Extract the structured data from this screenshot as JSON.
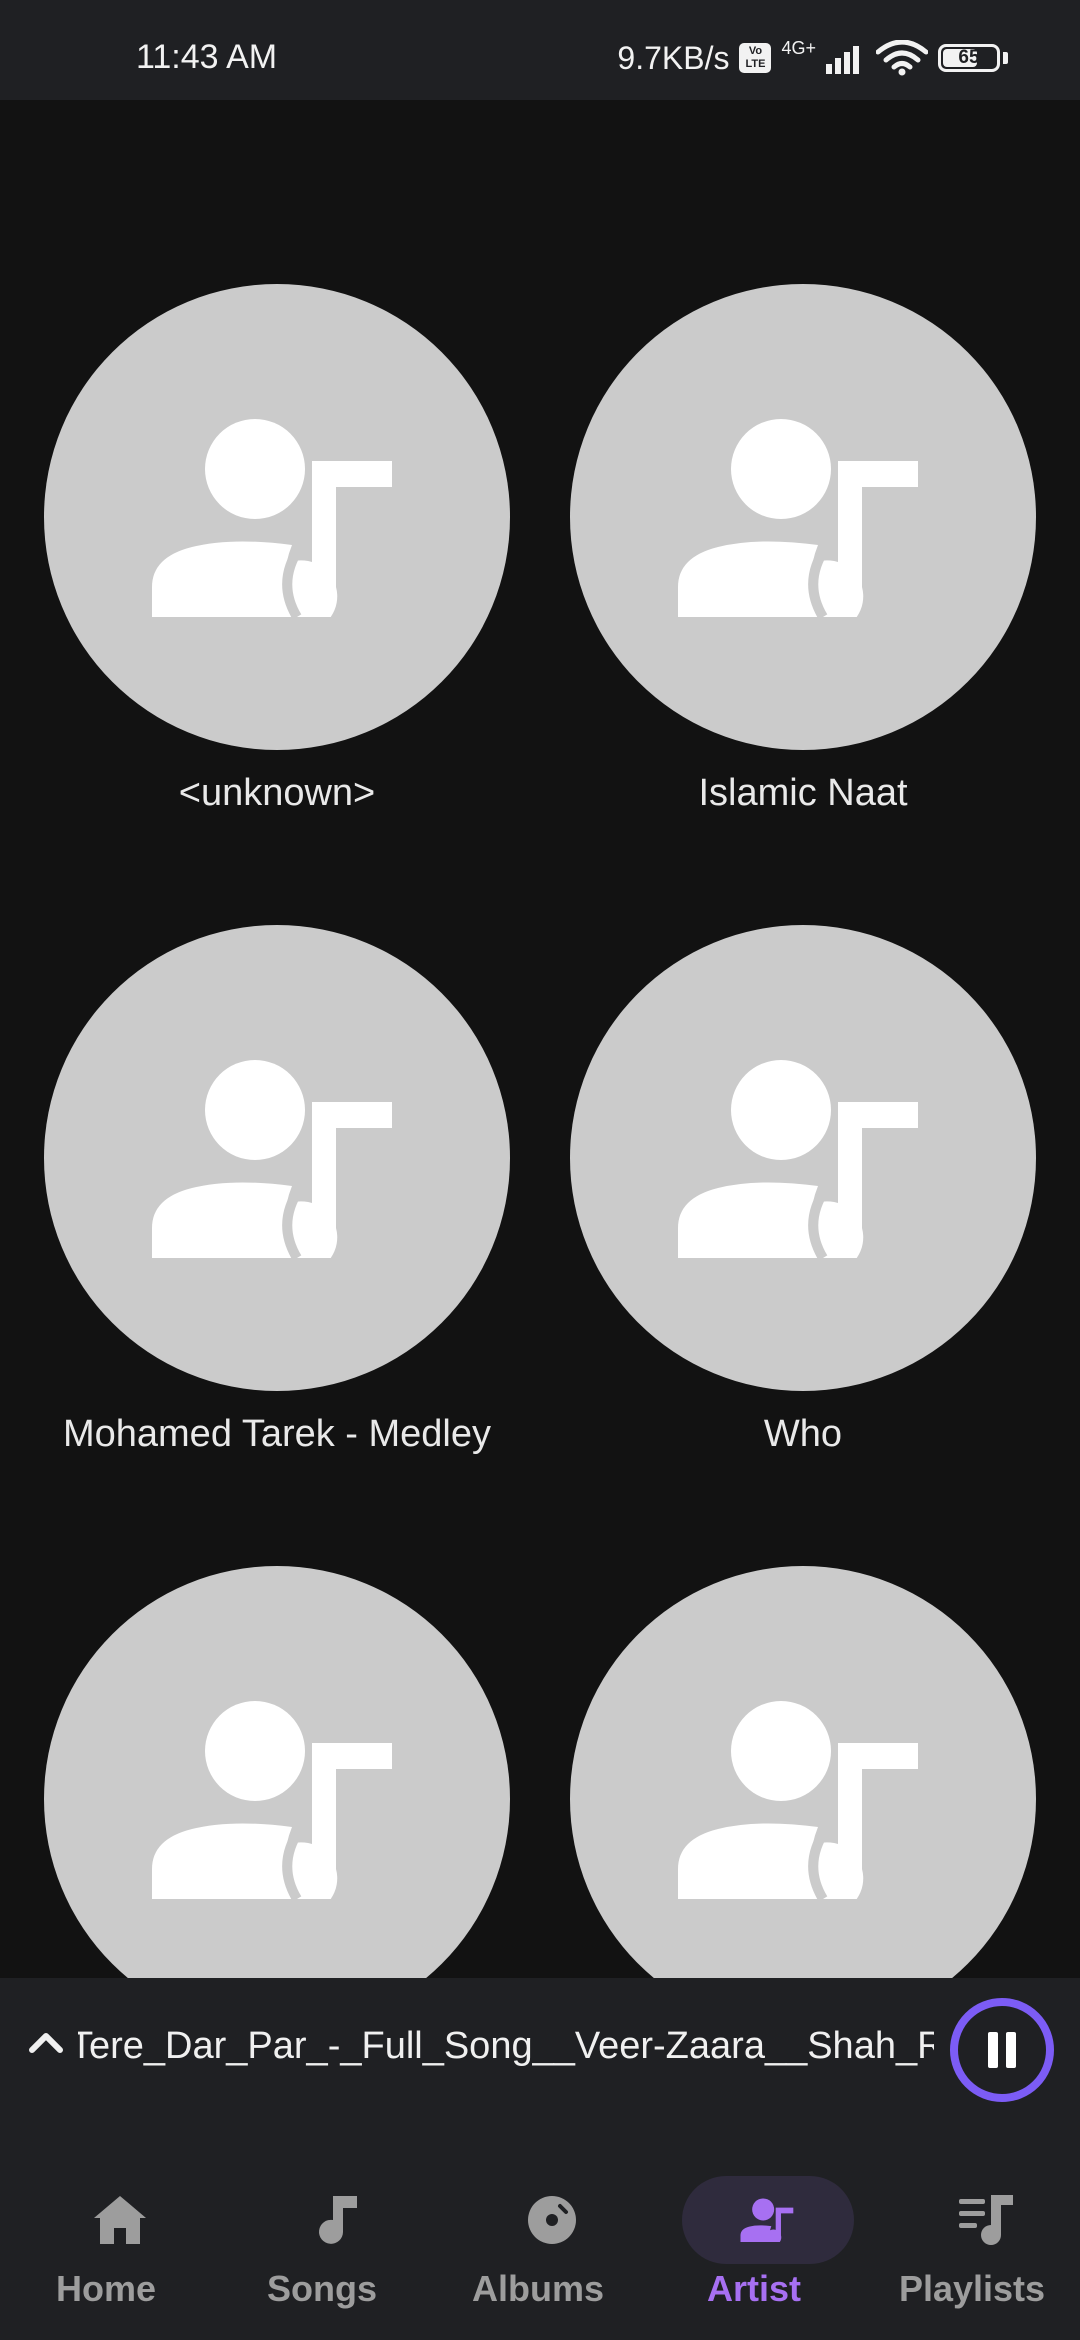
{
  "status_bar": {
    "time": "11:43 AM",
    "net_speed": "9.7KB/s",
    "volte_top": "Vo",
    "volte_bottom": "LTE",
    "network": "4G+",
    "battery": "65",
    "battery_level_pct": 65
  },
  "artists": [
    {
      "name": "<unknown>"
    },
    {
      "name": "Islamic Naat"
    },
    {
      "name": "Mohamed Tarek - Medley"
    },
    {
      "name": "Who"
    },
    {
      "name": ""
    },
    {
      "name": ""
    }
  ],
  "mini_player": {
    "track_title": "Tere_Dar_Par_-_Full_Song__Veer-Zaara__Shah_Rukh_Khan",
    "state": "playing"
  },
  "nav": {
    "items": [
      {
        "label": "Home",
        "icon": "home-icon"
      },
      {
        "label": "Songs",
        "icon": "music-note-icon"
      },
      {
        "label": "Albums",
        "icon": "album-icon"
      },
      {
        "label": "Artist",
        "icon": "artist-icon"
      },
      {
        "label": "Playlists",
        "icon": "playlist-icon"
      }
    ],
    "active": "Artist"
  },
  "colors": {
    "accent": "#7c5cf5",
    "active_label": "#a770f2",
    "background": "#121212",
    "bar_background": "#1f2023",
    "placeholder_art": "#cbcbcb"
  }
}
